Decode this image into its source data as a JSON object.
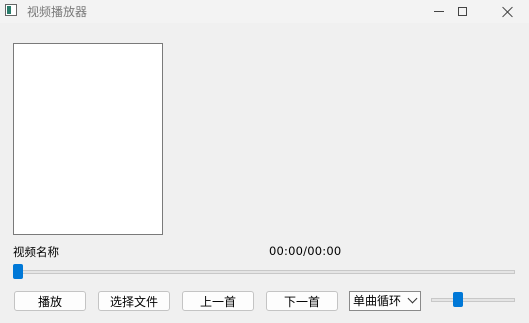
{
  "window": {
    "title": "视频播放器",
    "icons": {
      "app": "app-icon",
      "minimize": "minimize-icon",
      "maximize": "maximize-icon",
      "close": "close-icon"
    }
  },
  "player": {
    "video_name": "视频名称",
    "time": "00:00/00:00",
    "progress": 0
  },
  "controls": {
    "play_label": "播放",
    "select_file_label": "选择文件",
    "prev_label": "上一首",
    "next_label": "下一首",
    "loop_mode": "单曲循环",
    "volume": 0.3
  },
  "colors": {
    "accent": "#0078d7",
    "background": "#f0f0f0"
  }
}
